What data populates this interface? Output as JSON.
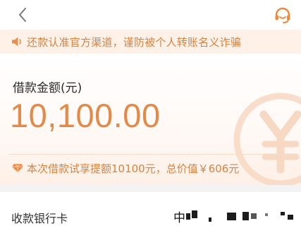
{
  "nav": {
    "back_icon": "chevron-left-icon",
    "service_icon": "headset-icon"
  },
  "notice": {
    "icon": "speaker-icon",
    "text": "还款认准官方渠道，谨防被个人转账名义诈骗"
  },
  "loan": {
    "amount_label": "借款金额(元)",
    "amount_value": "10,100.00",
    "benefit_icon": "diamond-icon",
    "benefit_text": "本次借款试享提额10100元，总价值￥606元"
  },
  "bank": {
    "label": "收款银行卡",
    "value_prefix": "中"
  },
  "colors": {
    "accent": "#e28a49",
    "notice_bg": "#fdf1e8",
    "notice_text": "#d9823e"
  }
}
